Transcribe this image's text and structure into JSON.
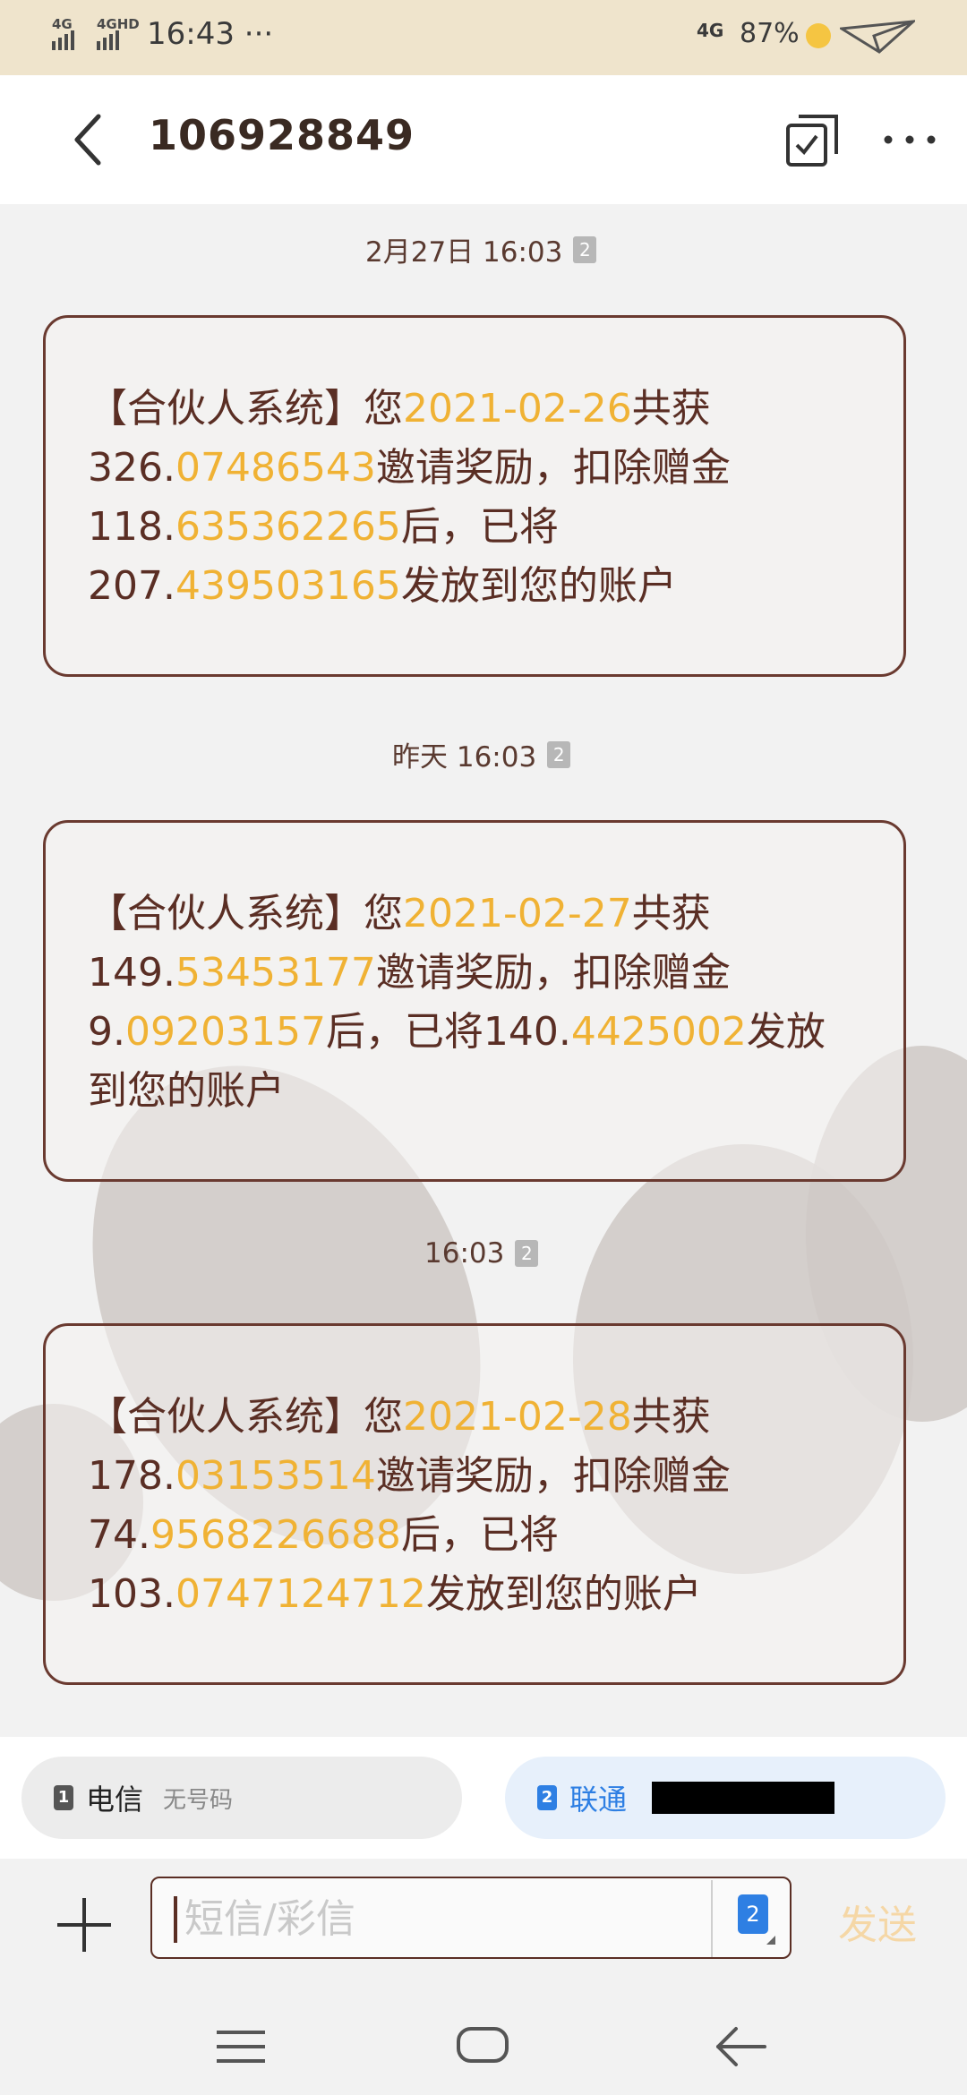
{
  "status_bar": {
    "signal1_label": "4G",
    "signal2_label": "4GHD",
    "time": "16:43",
    "overflow": "···",
    "network": "4G",
    "battery": "87%",
    "icons": [
      "signal-icon",
      "signal-icon",
      "charging-icon",
      "paper-plane-icon"
    ]
  },
  "header": {
    "title": "106928849",
    "back_icon": "chevron-left-icon",
    "select_icon": "multi-select-icon",
    "more_icon": "more-dots-icon"
  },
  "messages": [
    {
      "timestamp": "2月27日 16:03",
      "sim": "2",
      "parts": [
        {
          "t": "【合伙人系统】您",
          "h": false
        },
        {
          "t": "2021-02-26",
          "h": true
        },
        {
          "t": "共获",
          "h": false
        },
        {
          "t": "326.",
          "h": false
        },
        {
          "t": "07486543",
          "h": true
        },
        {
          "t": "邀请奖励，扣除赠金",
          "h": false
        },
        {
          "t": "118.",
          "h": false
        },
        {
          "t": "635362265",
          "h": true
        },
        {
          "t": "后，已将",
          "h": false
        },
        {
          "t": "207.",
          "h": false
        },
        {
          "t": "439503165",
          "h": true
        },
        {
          "t": "发放到您的账户",
          "h": false
        }
      ]
    },
    {
      "timestamp": "昨天 16:03",
      "sim": "2",
      "parts": [
        {
          "t": "【合伙人系统】您",
          "h": false
        },
        {
          "t": "2021-02-27",
          "h": true
        },
        {
          "t": "共获",
          "h": false
        },
        {
          "t": "149.",
          "h": false
        },
        {
          "t": "53453177",
          "h": true
        },
        {
          "t": "邀请奖励，扣除赠金",
          "h": false
        },
        {
          "t": "9.",
          "h": false
        },
        {
          "t": "09203157",
          "h": true
        },
        {
          "t": "后，已将140.",
          "h": false
        },
        {
          "t": "4425002",
          "h": true
        },
        {
          "t": "发放到您的账户",
          "h": false
        }
      ]
    },
    {
      "timestamp": "16:03",
      "sim": "2",
      "parts": [
        {
          "t": "【合伙人系统】您",
          "h": false
        },
        {
          "t": "2021-02-28",
          "h": true
        },
        {
          "t": "共获",
          "h": false
        },
        {
          "t": "178.",
          "h": false
        },
        {
          "t": "03153514",
          "h": true
        },
        {
          "t": "邀请奖励，扣除赠金",
          "h": false
        },
        {
          "t": "74.",
          "h": false
        },
        {
          "t": "9568226688",
          "h": true
        },
        {
          "t": "后，已将",
          "h": false
        },
        {
          "t": "103.",
          "h": false
        },
        {
          "t": "0747124712",
          "h": true
        },
        {
          "t": "发放到您的账户",
          "h": false
        }
      ]
    }
  ],
  "sim_bar": {
    "sim1_badge": "1",
    "sim1_carrier": "电信",
    "sim1_number": "无号码",
    "sim2_badge": "2",
    "sim2_carrier": "联通"
  },
  "composer": {
    "placeholder": "短信/彩信",
    "sim_badge": "2",
    "send_label": "发送",
    "add_icon": "plus-icon"
  },
  "nav_bar": {
    "icons": [
      "menu-icon",
      "home-icon",
      "back-icon"
    ]
  },
  "colors": {
    "highlight": "#f0b234",
    "text": "#5a2e24",
    "status_bg": "#efe4cc",
    "accent_blue": "#2e7fe3"
  }
}
